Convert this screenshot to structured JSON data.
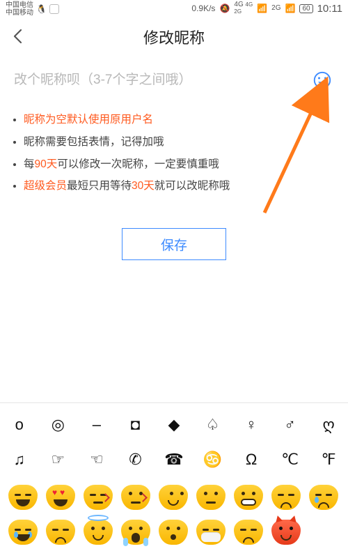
{
  "status": {
    "carrier1": "中国电信",
    "carrier2": "中国移动",
    "speed": "0.9K/s",
    "net_label_1": "4G",
    "net_sub_1a": "4G",
    "net_sub_1b": "2G",
    "net_label_2": "2G",
    "battery": "60",
    "time": "10:11"
  },
  "page": {
    "title": "修改昵称",
    "placeholder": "改个昵称呗（3-7个字之间哦）",
    "save": "保存"
  },
  "rules": {
    "r1": "昵称为空默认使用原用户名",
    "r2": "昵称需要包括表情，记得加哦",
    "r3a": "每",
    "r3b": "90天",
    "r3c": "可以修改一次昵称，一定要慎重哦",
    "r4a": "超级会员",
    "r4b": "最短只用等待",
    "r4c": "30天",
    "r4d": "就可以改昵称哦"
  },
  "symbols": {
    "row1": [
      "o",
      "◎",
      "–",
      "◘",
      "◆",
      "♤",
      "♀",
      "♂",
      "ღ"
    ],
    "row2": [
      "♫",
      "☞",
      "☜",
      "✆",
      "☎",
      "♋",
      "Ω",
      "℃",
      "℉"
    ]
  },
  "emoji": [
    {
      "name": "grin",
      "cls": "yellow closed",
      "mouth": "bigsmile"
    },
    {
      "name": "heart-eyes",
      "cls": "yellow hearts",
      "mouth": "bigsmile"
    },
    {
      "name": "kissing-closed",
      "cls": "yellow closed kiss",
      "mouth": "flat"
    },
    {
      "name": "kissing",
      "cls": "yellow kiss",
      "mouth": "flat"
    },
    {
      "name": "smirk",
      "cls": "yellow sideeye",
      "mouth": "smile"
    },
    {
      "name": "neutral",
      "cls": "yellow",
      "mouth": "flat"
    },
    {
      "name": "beaming",
      "cls": "yellow",
      "mouth": "teeth"
    },
    {
      "name": "pensive",
      "cls": "yellow closed",
      "mouth": "sad"
    },
    {
      "name": "sleepy",
      "cls": "yellow closed tear",
      "mouth": "sad"
    },
    {
      "name": "tears-of-joy",
      "cls": "yellow closed tear tear2",
      "mouth": "bigsmile"
    },
    {
      "name": "persevere",
      "cls": "yellow closed",
      "mouth": "sad"
    },
    {
      "name": "halo",
      "cls": "yellow halo",
      "mouth": "smile"
    },
    {
      "name": "scream",
      "cls": "yellow scream",
      "mouth": "oh"
    },
    {
      "name": "hushed",
      "cls": "yellow",
      "mouth": "oh"
    },
    {
      "name": "mask",
      "cls": "yellow closed mask",
      "mouth": "flat"
    },
    {
      "name": "disappointed",
      "cls": "yellow closed",
      "mouth": "sad"
    },
    {
      "name": "devil",
      "cls": "red devil",
      "mouth": "smile"
    }
  ]
}
